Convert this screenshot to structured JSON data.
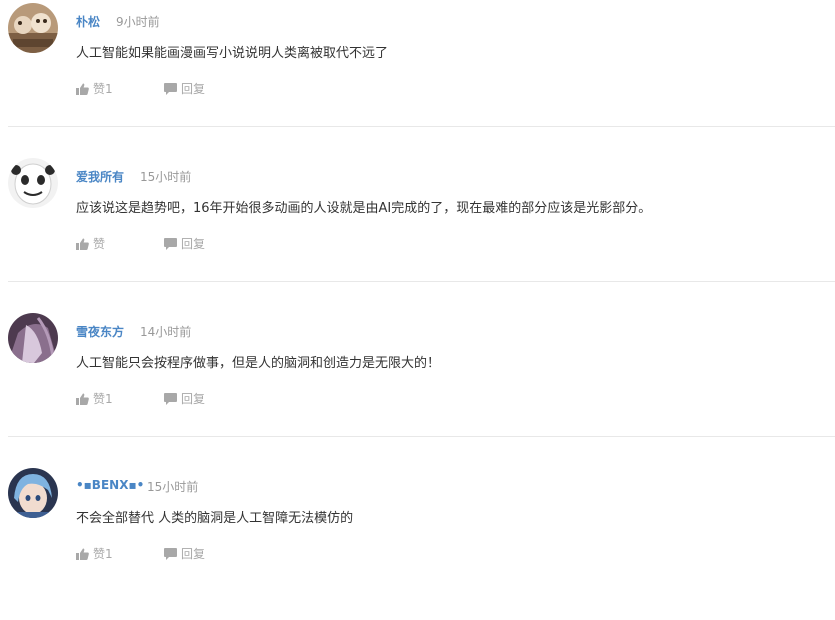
{
  "comments": [
    {
      "username": "朴松",
      "time": "9小时前",
      "content": "人工智能如果能画漫画写小说说明人类离被取代不远了",
      "like_label": "赞1",
      "reply_label": "回复"
    },
    {
      "username": "爱我所有",
      "time": "15小时前",
      "content": "应该说这是趋势吧，16年开始很多动画的人设就是由AI完成的了，现在最难的部分应该是光影部分。",
      "like_label": "赞",
      "reply_label": "回复"
    },
    {
      "username": "雪夜东方",
      "time": "14小时前",
      "content": "人工智能只会按程序做事，但是人的脑洞和创造力是无限大的！",
      "like_label": "赞1",
      "reply_label": "回复"
    },
    {
      "username": "•▪BENX▪•",
      "time": "15小时前",
      "content": "不会全部替代 人类的脑洞是人工智障无法模仿的",
      "like_label": "赞1",
      "reply_label": "回复"
    }
  ],
  "colors": {
    "username": "#4a86c5",
    "time": "#999999",
    "content": "#333333",
    "action": "#a8a8a8",
    "divider": "#e8e8e8"
  },
  "icons": {
    "like": "thumbs-up-icon",
    "reply": "speech-bubble-icon"
  }
}
